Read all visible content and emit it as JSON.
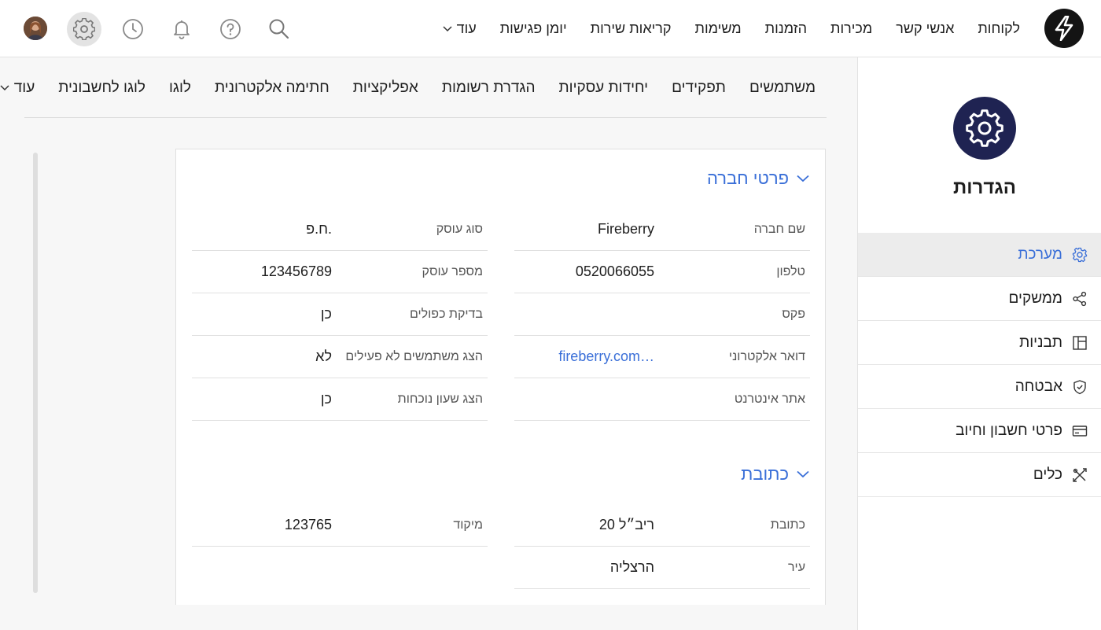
{
  "topbar": {
    "nav": [
      "לקוחות",
      "אנשי קשר",
      "מכירות",
      "הזמנות",
      "משימות",
      "קריאות שירות",
      "יומן פגישות"
    ],
    "more_label": "עוד",
    "icons": [
      "search-icon",
      "help-icon",
      "bell-icon",
      "history-icon",
      "gear-icon"
    ]
  },
  "sidebar": {
    "title": "הגדרות",
    "items": [
      {
        "label": "מערכת",
        "icon": "gear-icon"
      },
      {
        "label": "ממשקים",
        "icon": "share-icon"
      },
      {
        "label": "תבניות",
        "icon": "template-icon"
      },
      {
        "label": "אבטחה",
        "icon": "shield-icon"
      },
      {
        "label": "פרטי חשבון וחיוב",
        "icon": "card-icon"
      },
      {
        "label": "כלים",
        "icon": "tools-icon"
      }
    ],
    "active_color": "#3a6fd8"
  },
  "subtabs": {
    "items": [
      "משתמשים",
      "תפקידים",
      "יחידות עסקיות",
      "הגדרת רשומות",
      "אפליקציות",
      "חתימה אלקטרונית",
      "לוגו",
      "לוגו לחשבונית"
    ],
    "more_label": "עוד"
  },
  "company": {
    "section_title": "פרטי חברה",
    "right_fields": [
      {
        "label": "שם חברה",
        "value": "Fireberry"
      },
      {
        "label": "טלפון",
        "value": "0520066055"
      },
      {
        "label": "פקס",
        "value": ""
      },
      {
        "label": "דואר אלקטרוני",
        "value": "fireberry.com…"
      },
      {
        "label": "אתר אינטרנט",
        "value": ""
      }
    ],
    "left_fields": [
      {
        "label": "סוג עוסק",
        "value": "ח.פ."
      },
      {
        "label": "מספר עוסק",
        "value": "123456789"
      },
      {
        "label": "בדיקת כפולים",
        "value": "כן"
      },
      {
        "label": "הצג משתמשים לא פעילים",
        "value": "לא"
      },
      {
        "label": "הצג שעון נוכחות",
        "value": "כן"
      }
    ]
  },
  "address": {
    "section_title": "כתובת",
    "right_fields": [
      {
        "label": "כתובת",
        "value": "ריב״ל 20"
      },
      {
        "label": "עיר",
        "value": "הרצליה"
      }
    ],
    "left_fields": [
      {
        "label": "מיקוד",
        "value": "123765"
      }
    ]
  },
  "colors": {
    "accent": "#3a6fd8",
    "badge": "#1f2352"
  }
}
